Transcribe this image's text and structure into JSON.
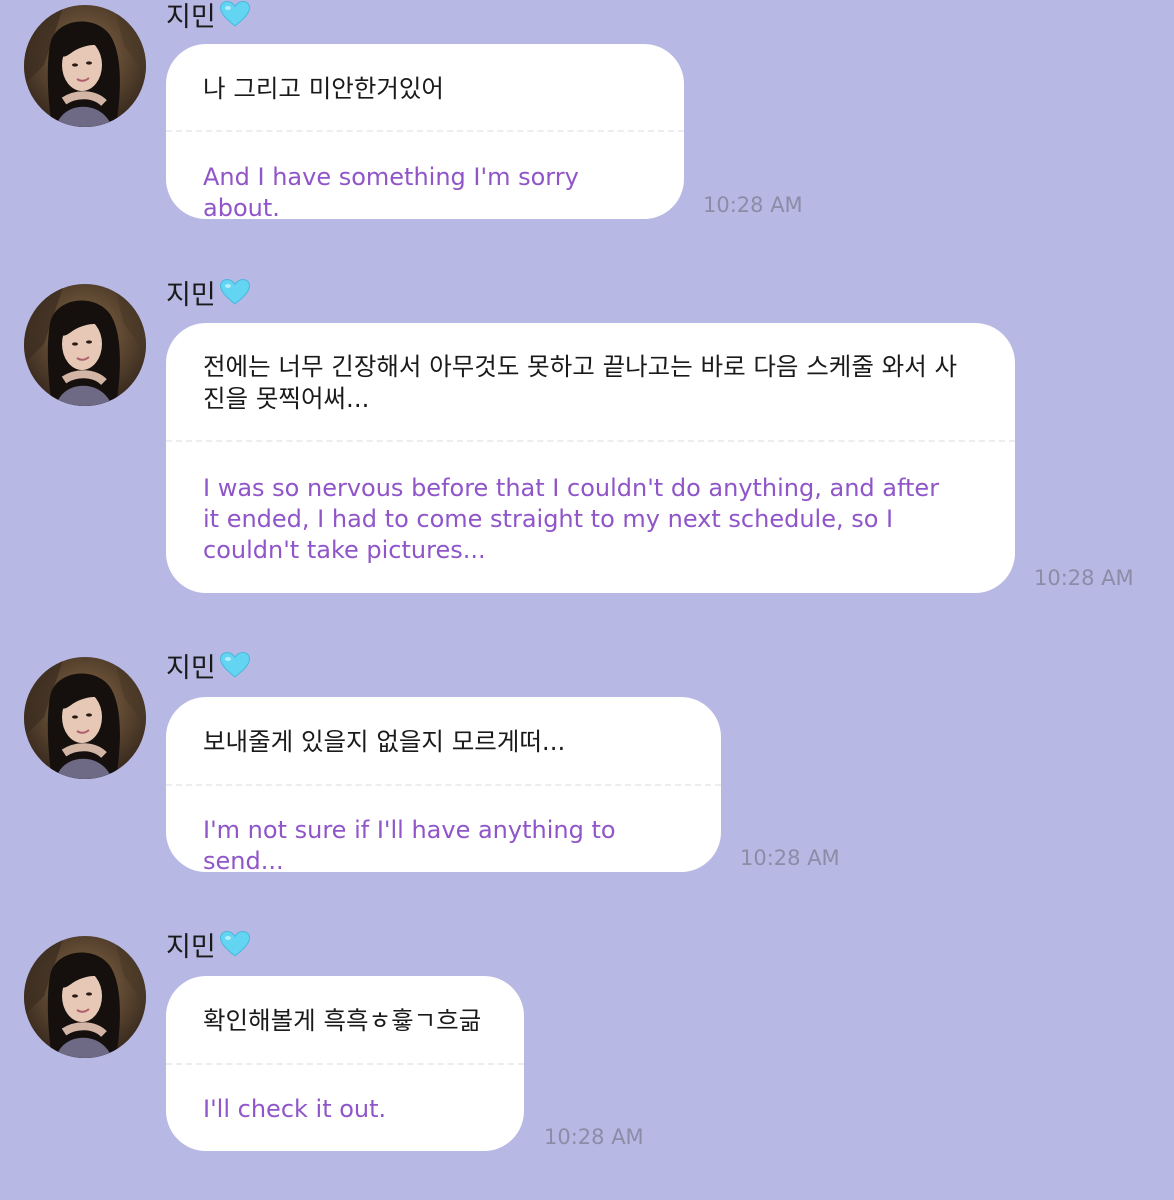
{
  "messages": [
    {
      "sender": "지민",
      "original": "나 그리고 미안한거있어",
      "translation": "And I have something I'm sorry about.",
      "time": "10:28 AM"
    },
    {
      "sender": "지민",
      "original": "전에는 너무 긴장해서 아무것도 못하고 끝나고는 바로 다음 스케줄 와서 사진을 못찍어써...",
      "translation": "I was so nervous before that I couldn't do anything, and after it ended, I had to come straight to my next schedule, so I couldn't take pictures...",
      "time": "10:28 AM"
    },
    {
      "sender": "지민",
      "original": "보내줄게 있을지 없을지 모르게떠...",
      "translation": "I'm not sure if I'll have anything to send...",
      "time": "10:28 AM"
    },
    {
      "sender": "지민",
      "original": "확인해볼게 흑흑ㅎ흏ㄱ흐긂",
      "translation": "I'll check it out.",
      "time": "10:28 AM"
    }
  ],
  "colors": {
    "background": "#b8b8e4",
    "bubble": "#ffffff",
    "translation_text": "#8f55c9",
    "timestamp": "#8c8ca6",
    "heart": "#63d4f2"
  },
  "icons": {
    "heart": "light-blue-heart-emoji"
  }
}
